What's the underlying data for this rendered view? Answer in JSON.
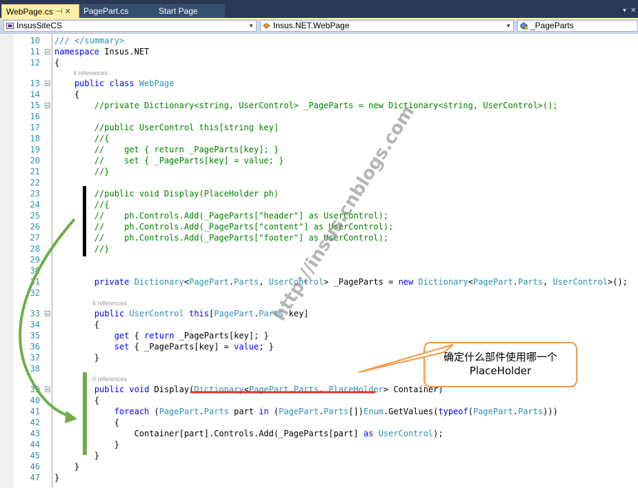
{
  "tabs": [
    {
      "label": "WebPage.cs",
      "active": true,
      "pin_glyph": "⊣ ✕"
    },
    {
      "label": "PagePart.cs",
      "active": false
    },
    {
      "label": "Start Page",
      "active": false
    }
  ],
  "navbar": {
    "project": "InsusSiteCS",
    "class": "Insus.NET.WebPage",
    "member": "_PageParts"
  },
  "code_lines": [
    {
      "n": "10",
      "code": "/// </summary>",
      "kind": "xmldoc"
    },
    {
      "n": "11",
      "code": "namespace Insus.NET",
      "kind": "ns"
    },
    {
      "n": "12",
      "code": "{",
      "kind": "plain"
    },
    {
      "refs": "4 references"
    },
    {
      "n": "13",
      "code": "    public class WebPage",
      "kind": "class"
    },
    {
      "n": "14",
      "code": "    {",
      "kind": "plain"
    },
    {
      "n": "15",
      "code": "        //private Dictionary<string, UserControl> _PageParts = new Dictionary<string, UserControl>();",
      "kind": "comment"
    },
    {
      "n": "16",
      "code": "",
      "kind": "plain"
    },
    {
      "n": "17",
      "code": "        //public UserControl this[string key]",
      "kind": "comment"
    },
    {
      "n": "18",
      "code": "        //{",
      "kind": "comment"
    },
    {
      "n": "19",
      "code": "        //    get { return _PageParts[key]; }",
      "kind": "comment"
    },
    {
      "n": "20",
      "code": "        //    set { _PageParts[key] = value; }",
      "kind": "comment"
    },
    {
      "n": "21",
      "code": "        //}",
      "kind": "comment"
    },
    {
      "n": "22",
      "code": "",
      "kind": "plain"
    },
    {
      "n": "23",
      "code": "        //public void Display(PlaceHolder ph)",
      "kind": "comment"
    },
    {
      "n": "24",
      "code": "        //{",
      "kind": "comment"
    },
    {
      "n": "25",
      "code": "        //    ph.Controls.Add(_PageParts[\"header\"] as UserControl);",
      "kind": "comment"
    },
    {
      "n": "26",
      "code": "        //    ph.Controls.Add(_PageParts[\"content\"] as UserControl);",
      "kind": "comment"
    },
    {
      "n": "27",
      "code": "        //    ph.Controls.Add(_PageParts[\"footer\"] as UserControl);",
      "kind": "comment"
    },
    {
      "n": "28",
      "code": "        //}",
      "kind": "comment"
    },
    {
      "n": "29",
      "code": "",
      "kind": "plain"
    },
    {
      "n": "30",
      "code": "",
      "kind": "plain"
    },
    {
      "n": "31",
      "code": "        private Dictionary<PagePart.Parts, UserControl> _PageParts = new Dictionary<PagePart.Parts, UserControl>();",
      "kind": "field"
    },
    {
      "n": "32",
      "code": "",
      "kind": "plain"
    },
    {
      "refs": "6 references"
    },
    {
      "n": "33",
      "code": "        public UserControl this[PagePart.Parts key]",
      "kind": "indexer"
    },
    {
      "n": "34",
      "code": "        {",
      "kind": "plain"
    },
    {
      "n": "35",
      "code": "            get { return _PageParts[key]; }",
      "kind": "get"
    },
    {
      "n": "36",
      "code": "            set { _PageParts[key] = value; }",
      "kind": "set"
    },
    {
      "n": "37",
      "code": "        }",
      "kind": "plain"
    },
    {
      "n": "38",
      "code": "",
      "kind": "plain"
    },
    {
      "refs": "0 references"
    },
    {
      "n": "39",
      "code": "        public void Display(Dictionary<PagePart.Parts, PlaceHolder> Container)",
      "kind": "display"
    },
    {
      "n": "40",
      "code": "        {",
      "kind": "plain"
    },
    {
      "n": "41",
      "code": "            foreach (PagePart.Parts part in (PagePart.Parts[])Enum.GetValues(typeof(PagePart.Parts)))",
      "kind": "foreach"
    },
    {
      "n": "42",
      "code": "            {",
      "kind": "plain"
    },
    {
      "n": "43",
      "code": "                Container[part].Controls.Add(_PageParts[part] as UserControl);",
      "kind": "add"
    },
    {
      "n": "44",
      "code": "            }",
      "kind": "plain"
    },
    {
      "n": "45",
      "code": "        }",
      "kind": "plain"
    },
    {
      "n": "46",
      "code": "    }",
      "kind": "plain"
    },
    {
      "n": "47",
      "code": "}",
      "kind": "plain"
    }
  ],
  "callout": {
    "line1": "确定什么部件使用哪一个",
    "line2": "PlaceHolder"
  },
  "watermark": "http://insus.cnblogs.com",
  "colors": {
    "tab_strip": "#293955",
    "active_tab": "#fff1a8",
    "keyword": "#0000ff",
    "type": "#2b91af",
    "comment": "#008000",
    "callout_border": "#f79646",
    "green_marker": "#70ad47",
    "red_underline": "#e03030",
    "black_marker": "#000000"
  }
}
